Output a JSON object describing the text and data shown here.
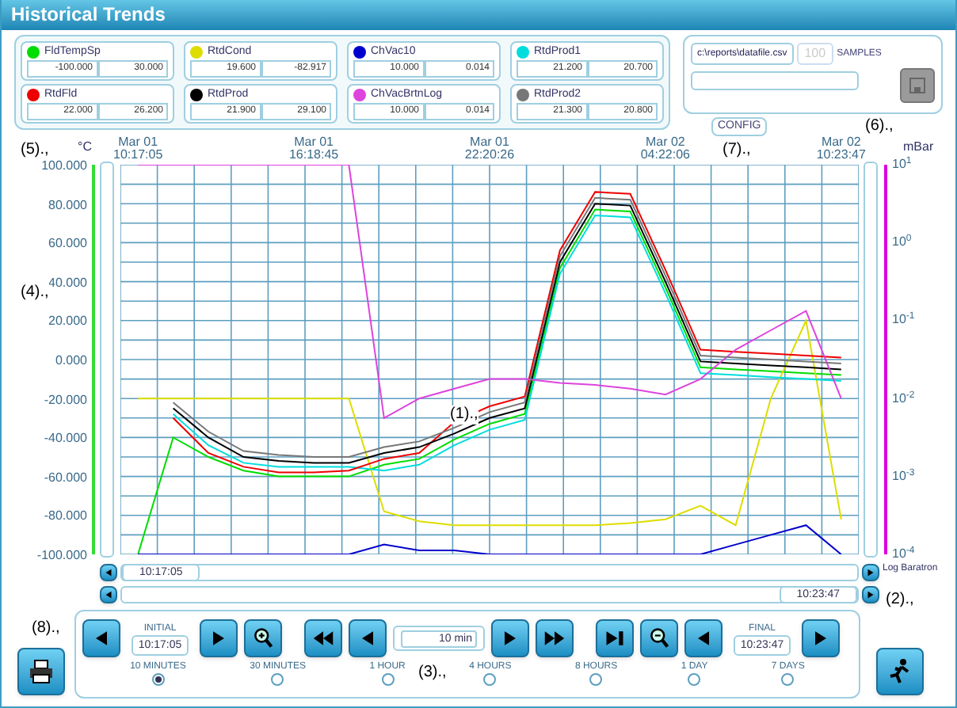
{
  "window": {
    "title": "Historical Trends"
  },
  "legend": [
    {
      "min": "-100.000",
      "max": "30.000"
    },
    {
      "min": "19.600",
      "max": "-82.917"
    },
    {
      "min": "10.000",
      "max": "0.014"
    },
    {
      "min": "21.200",
      "max": "20.700"
    },
    {
      "min": "22.000",
      "max": "26.200"
    },
    {
      "min": "21.900",
      "max": "29.100"
    },
    {
      "min": "10.000",
      "max": "0.014"
    },
    {
      "min": "21.300",
      "max": "20.800"
    }
  ],
  "file_panel": {
    "path": "c:\\reports\\datafile.csv",
    "samples": "100",
    "samples_label": "SAMPLES",
    "save_disabled": true
  },
  "config_button": "CONFIG",
  "chart": {
    "left_unit": "°C",
    "right_unit": "mBar",
    "right_axis_label": "Log Baratron",
    "right_ticks": [
      "10$^{1}$",
      "10$^{0}$",
      "10$^{-1}$",
      "10$^{-2}$",
      "10$^{-3}$",
      "10$^{-4}$"
    ],
    "chart_data": {
      "type": "line",
      "grid": true,
      "categories": [
        "Mar 01 10:17:05",
        null,
        null,
        null,
        null,
        "Mar 01 16:18:45",
        null,
        null,
        null,
        null,
        "Mar 01 22:20:26",
        null,
        null,
        null,
        null,
        "Mar 02 04:22:06",
        null,
        null,
        null,
        null,
        "Mar 02 10:23:47"
      ],
      "ylim": [
        -100,
        100
      ],
      "yticks": [
        {
          "value": 100,
          "label": "100.000"
        },
        {
          "value": 80,
          "label": "80.000"
        },
        {
          "value": 60,
          "label": "60.000"
        },
        {
          "value": 40,
          "label": "40.000"
        },
        {
          "value": 20,
          "label": "20.000"
        },
        {
          "value": 0,
          "label": "0.000"
        },
        {
          "value": -20,
          "label": "-20.000"
        },
        {
          "value": -40,
          "label": "-40.000"
        },
        {
          "value": -60,
          "label": "-60.000"
        },
        {
          "value": -80,
          "label": "-80.000"
        },
        {
          "value": -100,
          "label": "-100.000"
        }
      ],
      "series": [
        {
          "name": "FldTempSp",
          "color": "#00dd00",
          "values": [
            -100,
            -40,
            -50,
            -57,
            -60,
            -60,
            -60,
            -54,
            -51,
            -41,
            -33,
            -28,
            47,
            77,
            76,
            37,
            -4,
            -5,
            -6,
            -7,
            -8
          ]
        },
        {
          "name": "RtdCond",
          "color": "#dddd00",
          "values": [
            -20,
            -20,
            -20,
            -20,
            -20,
            -20,
            -20,
            -78,
            -83,
            -85,
            -85,
            -85,
            -85,
            -85,
            -84,
            -82,
            -75,
            -85,
            -20,
            20,
            -82
          ]
        },
        {
          "name": "ChVac10",
          "color": "#0000cc",
          "values": [
            -100,
            -100,
            -100,
            -100,
            -100,
            -100,
            -100,
            -95,
            -98,
            -98,
            -100,
            -100,
            -100,
            -100,
            -100,
            -100,
            -100,
            -95,
            -90,
            -85,
            -100
          ]
        },
        {
          "name": "RtdProd1",
          "color": "#00dddd",
          "values": [
            null,
            -28,
            -44,
            -53,
            -55,
            -55,
            -55,
            -57,
            -54,
            -44,
            -36,
            -31,
            44,
            74,
            73,
            34,
            -7,
            -8,
            -9,
            -10,
            -11
          ]
        },
        {
          "name": "RtdFld",
          "color": "#ee0000",
          "values": [
            null,
            -30,
            -48,
            -55,
            -58,
            -58,
            -57,
            -51,
            -48,
            -32,
            -24,
            -19,
            56,
            86,
            85,
            46,
            5,
            4,
            3,
            2,
            1
          ]
        },
        {
          "name": "RtdProd",
          "color": "#000000",
          "values": [
            null,
            -25,
            -40,
            -50,
            -52,
            -53,
            -53,
            -48,
            -45,
            -38,
            -30,
            -25,
            50,
            80,
            79,
            40,
            -1,
            -2,
            -3,
            -4,
            -5
          ]
        },
        {
          "name": "ChVacBrtnLog",
          "color": "#dd44dd",
          "values": [
            100,
            100,
            100,
            100,
            100,
            100,
            100,
            -30,
            -20,
            -15,
            -10,
            -10,
            -12,
            -13,
            -15,
            -18,
            -10,
            5,
            15,
            25,
            -20
          ]
        },
        {
          "name": "RtdProd2",
          "color": "#777777",
          "values": [
            null,
            -22,
            -37,
            -47,
            -49,
            -50,
            -50,
            -45,
            -42,
            -35,
            -27,
            -22,
            53,
            83,
            82,
            43,
            2,
            1,
            0,
            -1,
            -2
          ]
        }
      ]
    }
  },
  "scroll_start": "10:17:05",
  "scroll_end": "10:23:47",
  "controls": {
    "initial_label": "INITIAL",
    "initial_time": "10:17:05",
    "span": "10 min",
    "final_label": "FINAL",
    "final_time": "10:23:47",
    "ranges": [
      {
        "label": "10 MINUTES",
        "selected": true
      },
      {
        "label": "30 MINUTES",
        "selected": false
      },
      {
        "label": "1 HOUR",
        "selected": false
      },
      {
        "label": "4 HOURS",
        "selected": false
      },
      {
        "label": "8 HOURS",
        "selected": false
      },
      {
        "label": "1 DAY",
        "selected": false
      },
      {
        "label": "7 DAYS",
        "selected": false
      }
    ]
  },
  "annotations": [
    {
      "label": "(5).,",
      "kind": "axis-left"
    },
    {
      "label": "(4).,",
      "kind": "scroll-left"
    },
    {
      "label": "(1).,",
      "kind": "plot"
    },
    {
      "label": "(6).,",
      "kind": "axis-right"
    },
    {
      "label": "(7).,",
      "kind": "header"
    },
    {
      "label": "(2).,",
      "kind": "scroll-right"
    },
    {
      "label": "(3).,",
      "kind": "ranges"
    },
    {
      "label": "(8).,",
      "kind": "print"
    }
  ]
}
